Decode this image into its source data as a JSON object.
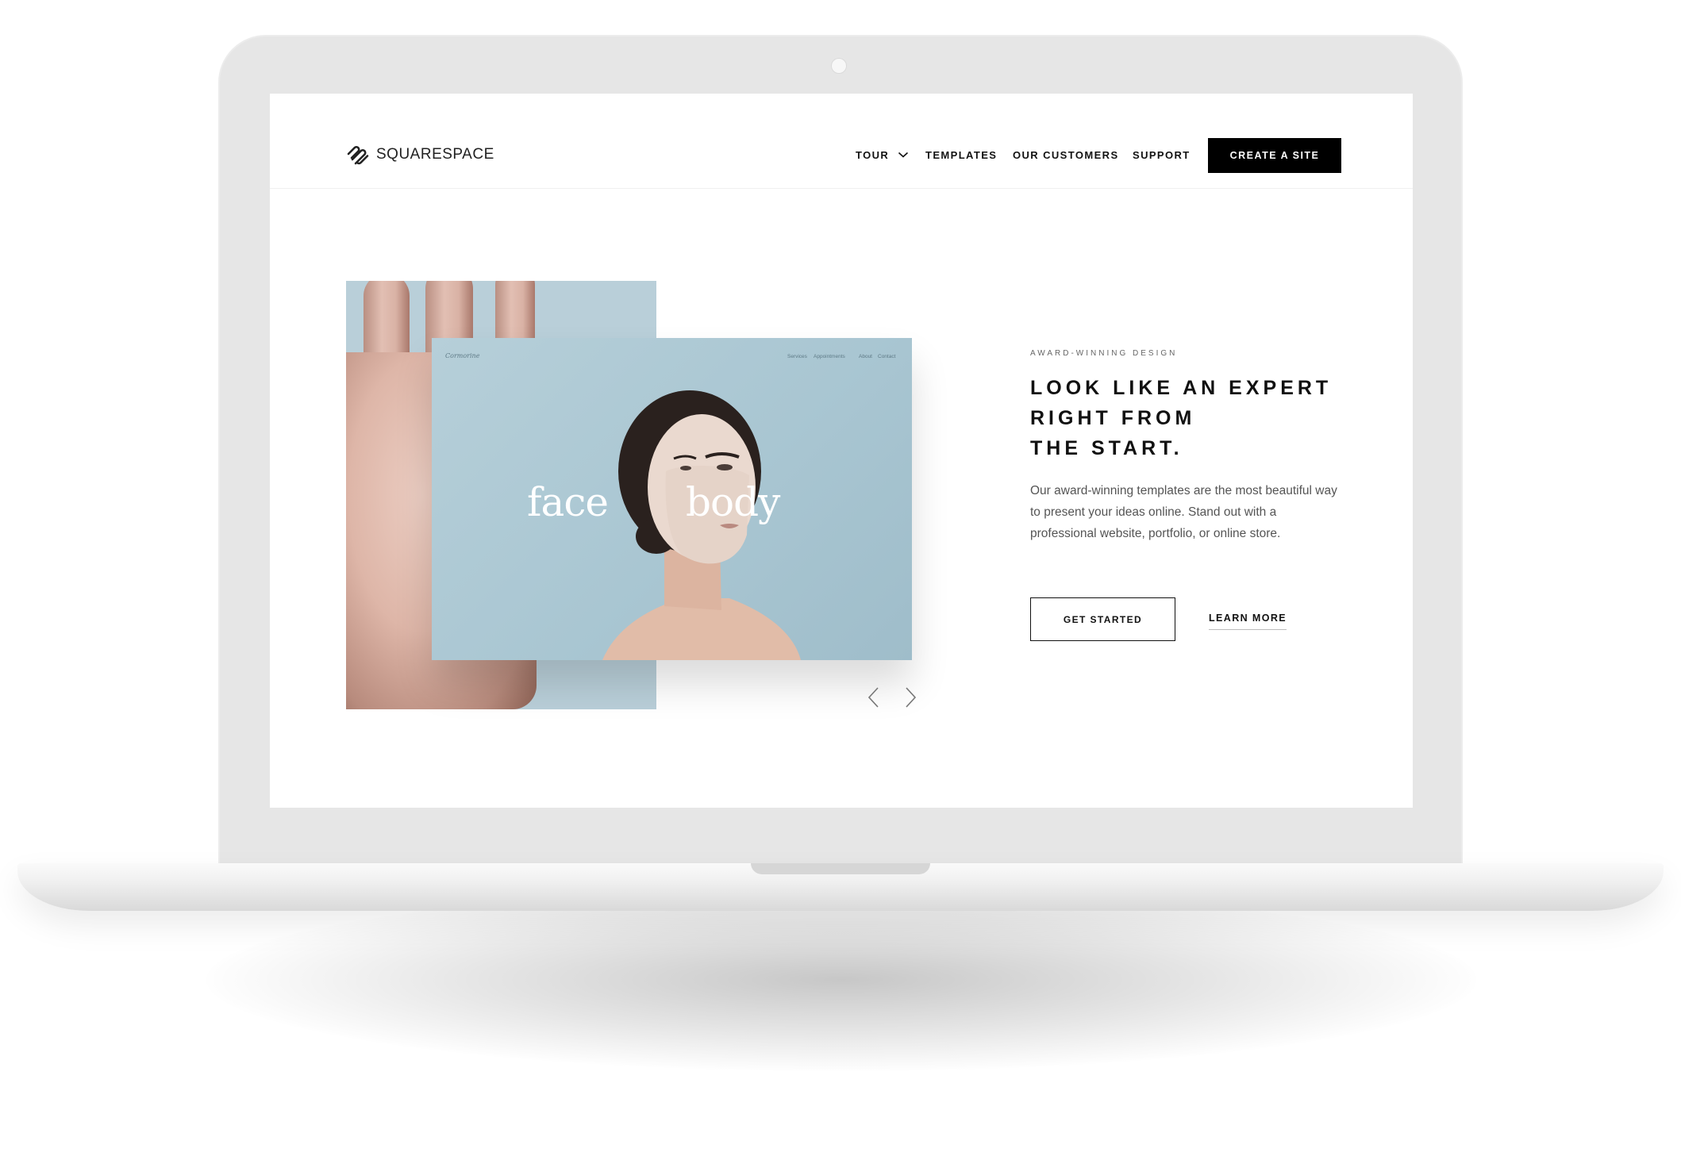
{
  "brand": {
    "name": "SQUARESPACE",
    "logo_icon": "squarespace-logo-icon"
  },
  "nav": {
    "items": [
      {
        "label": "TOUR",
        "has_dropdown": true
      },
      {
        "label": "TEMPLATES"
      },
      {
        "label": "OUR CUSTOMERS"
      },
      {
        "label": "SUPPORT"
      }
    ],
    "cta_label": "CREATE A SITE"
  },
  "hero": {
    "eyebrow": "AWARD-WINNING DESIGN",
    "headline_lines": [
      "LOOK LIKE AN EXPERT",
      "RIGHT FROM",
      "THE START."
    ],
    "body": "Our award-winning templates are the most beautiful way to present your ideas online. Stand out with a professional website, portfolio, or online store.",
    "primary_button": "GET STARTED",
    "secondary_link": "LEARN MORE"
  },
  "template_preview": {
    "site_logo": "Cormorine",
    "nav_items": [
      "Services",
      "Appointments",
      "About",
      "Contact"
    ],
    "words": [
      "face",
      "body"
    ]
  },
  "carousel": {
    "prev_icon": "chevron-left-icon",
    "next_icon": "chevron-right-icon"
  },
  "colors": {
    "accent": "#000000",
    "preview_bg": "#b6cfd9",
    "text": "#111111",
    "body_text": "#555555"
  }
}
